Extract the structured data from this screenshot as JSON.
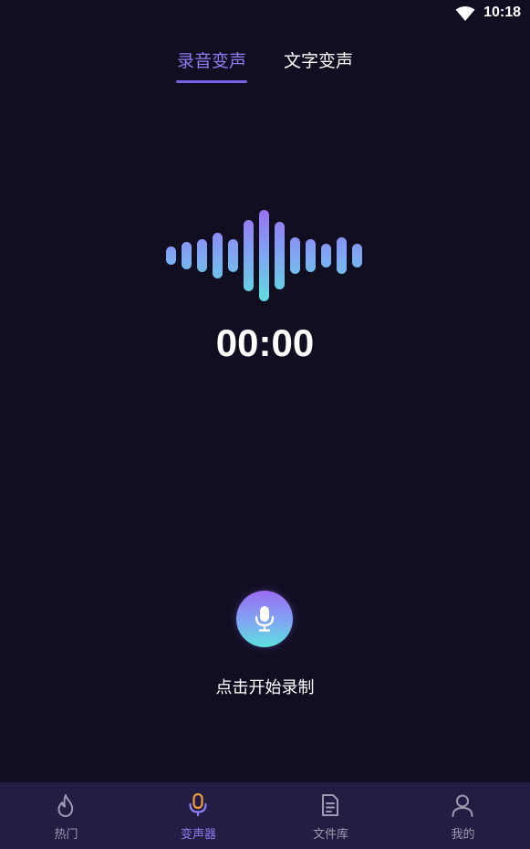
{
  "status_bar": {
    "time": "10:18",
    "wifi_icon": "wifi-icon"
  },
  "tabs": [
    {
      "label": "录音变声",
      "active": true
    },
    {
      "label": "文字变声",
      "active": false
    }
  ],
  "recorder": {
    "timer": "00:00",
    "hint": "点击开始录制",
    "button_icon": "microphone-icon"
  },
  "bottom_nav": {
    "items": [
      {
        "label": "热门",
        "icon": "flame-icon",
        "active": false
      },
      {
        "label": "变声器",
        "icon": "microphone-icon",
        "active": true
      },
      {
        "label": "文件库",
        "icon": "document-icon",
        "active": false
      },
      {
        "label": "我的",
        "icon": "user-icon",
        "active": false
      }
    ]
  },
  "colors": {
    "background": "#120e22",
    "accent": "#8f7cf0",
    "nav_background": "#221d42",
    "inactive_text": "#9d9bb3",
    "wave_top": "#9b6cf2",
    "wave_bottom": "#5ce1dd"
  }
}
